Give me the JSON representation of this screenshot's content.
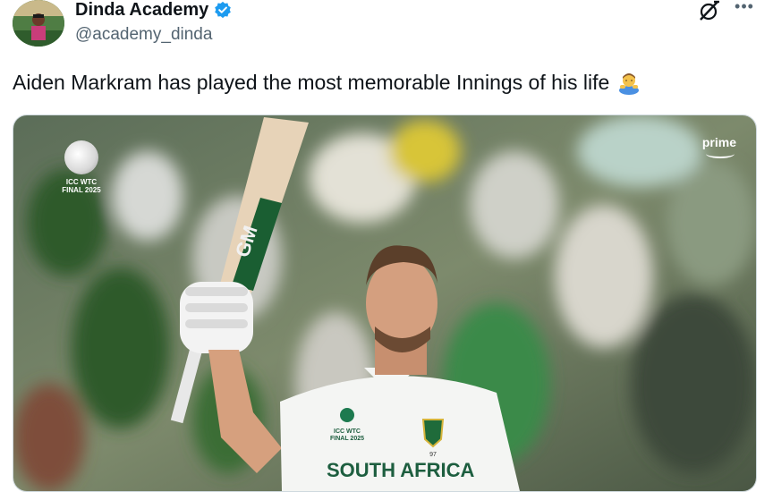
{
  "user": {
    "display_name": "Dinda Academy",
    "handle": "@academy_dinda"
  },
  "tweet": {
    "text": "Aiden Markram has played the most memorable Innings of his life",
    "emoji": "man-bowing-emoji"
  },
  "media": {
    "logo_text_line1": "ICC WTC",
    "logo_text_line2": "FINAL 2025",
    "broadcaster": "prime",
    "bat_brand": "GM",
    "shirt_logo_line1": "ICC WTC",
    "shirt_logo_line2": "FINAL 2025",
    "shirt_text": "SOUTH AFRICA",
    "shirt_number": "97"
  },
  "colors": {
    "verified_blue": "#1d9bf0",
    "handle_gray": "#536471",
    "text_dark": "#0f1419"
  },
  "icons": [
    "verified-badge-icon",
    "grok-icon",
    "more-options-icon"
  ]
}
